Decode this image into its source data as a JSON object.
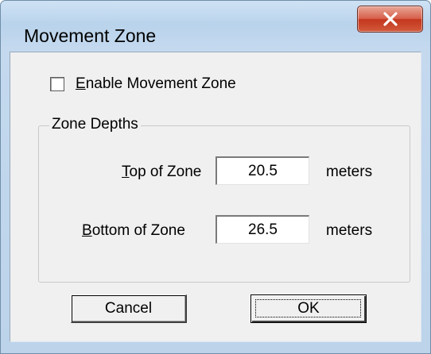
{
  "window": {
    "title": "Movement Zone",
    "close_symbol": "x"
  },
  "checkbox": {
    "label_mnemonic": "E",
    "label_rest": "nable Movement Zone",
    "checked": false
  },
  "group": {
    "legend": "Zone Depths",
    "fields": [
      {
        "label_mnemonic": "T",
        "label_rest": "op of Zone",
        "value": "20.5",
        "unit": "meters"
      },
      {
        "label_mnemonic": "B",
        "label_rest": "ottom of Zone",
        "value": "26.5",
        "unit": "meters"
      }
    ]
  },
  "buttons": {
    "cancel_label": "Cancel",
    "ok_label": "OK"
  },
  "colors": {
    "dialog_face": "#f0f0f0",
    "titlebar": "#b9d3ec",
    "close_button": "#c3371d"
  }
}
